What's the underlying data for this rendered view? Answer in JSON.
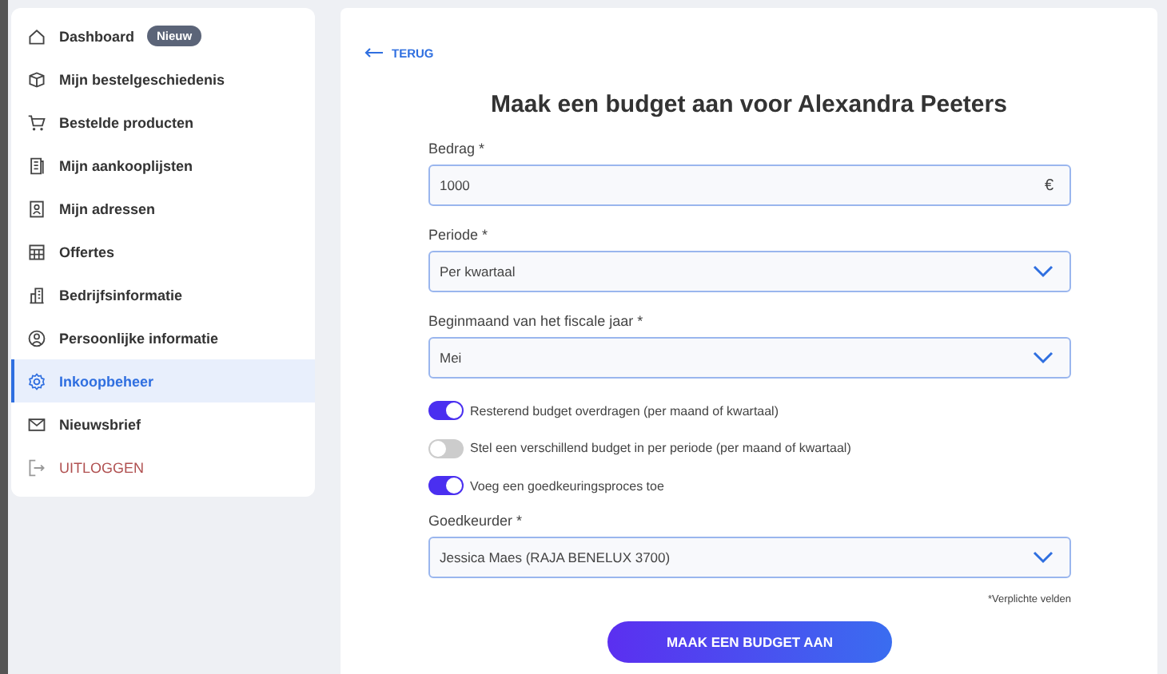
{
  "sidebar": {
    "items": [
      {
        "label": "Dashboard",
        "badge": "Nieuw",
        "selected": false,
        "kind": "link"
      },
      {
        "label": "Mijn bestelgeschiedenis",
        "selected": false,
        "kind": "link"
      },
      {
        "label": "Bestelde producten",
        "selected": false,
        "kind": "link"
      },
      {
        "label": "Mijn aankooplijsten",
        "selected": false,
        "kind": "link"
      },
      {
        "label": "Mijn adressen",
        "selected": false,
        "kind": "link"
      },
      {
        "label": "Offertes",
        "selected": false,
        "kind": "link"
      },
      {
        "label": "Bedrijfsinformatie",
        "selected": false,
        "kind": "link"
      },
      {
        "label": "Persoonlijke informatie",
        "selected": false,
        "kind": "link"
      },
      {
        "label": "Inkoopbeheer",
        "selected": true,
        "kind": "link"
      },
      {
        "label": "Nieuwsbrief",
        "selected": false,
        "kind": "link"
      },
      {
        "label": "UITLOGGEN",
        "selected": false,
        "kind": "logout"
      }
    ]
  },
  "main": {
    "back_link": "TERUG",
    "title": "Maak een budget aan voor Alexandra Peeters",
    "fields": [
      {
        "kind": "input",
        "label": "Bedrag *",
        "value": "1000",
        "suffix": "€"
      },
      {
        "kind": "select",
        "label": "Periode *",
        "value": "Per kwartaal"
      },
      {
        "kind": "select",
        "label": "Beginmaand van het fiscale jaar *",
        "value": "Mei"
      }
    ],
    "toggles": [
      {
        "label": "Resterend budget overdragen (per maand of kwartaal)",
        "on": true
      },
      {
        "label": "Stel een verschillend budget in per periode (per maand of kwartaal)",
        "on": false
      },
      {
        "label": "Voeg een goedkeuringsproces toe",
        "on": true
      }
    ],
    "approver": {
      "kind": "select",
      "label": "Goedkeurder *",
      "value": "Jessica Maes (RAJA BENELUX 3700)"
    },
    "required_note": "*Verplichte velden",
    "submit_button": "MAAK EEN BUDGET AAN"
  }
}
